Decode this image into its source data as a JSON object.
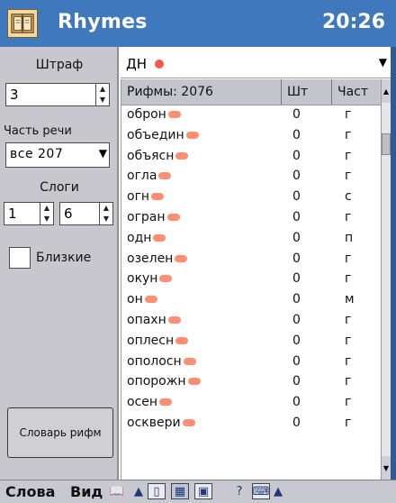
{
  "titlebar": {
    "app_title": "Rhymes",
    "clock": "20:26"
  },
  "left_panel": {
    "penalty_label": "Штраф",
    "penalty_value": "3",
    "pos_label": "Часть речи",
    "pos_value": "все   207",
    "syllables_label": "Слоги",
    "syllables_from": "1",
    "syllables_to": "6",
    "close_label": "Близкие",
    "dictionary_button": "Словарь рифм"
  },
  "search": {
    "value": "ДН"
  },
  "table": {
    "header_rhymes": "Рифмы: 2076",
    "header_count": "Шт",
    "header_part": "Част",
    "rows": [
      {
        "word": "оброн",
        "count": "0",
        "part": "г"
      },
      {
        "word": "объедин",
        "count": "0",
        "part": "г"
      },
      {
        "word": "объясн",
        "count": "0",
        "part": "г"
      },
      {
        "word": "огла",
        "count": "0",
        "part": "г"
      },
      {
        "word": "огн",
        "count": "0",
        "part": "с"
      },
      {
        "word": "огран",
        "count": "0",
        "part": "г"
      },
      {
        "word": "одн",
        "count": "0",
        "part": "п"
      },
      {
        "word": "озелен",
        "count": "0",
        "part": "г"
      },
      {
        "word": "окун",
        "count": "0",
        "part": "г"
      },
      {
        "word": "он",
        "count": "0",
        "part": "м"
      },
      {
        "word": "опахн",
        "count": "0",
        "part": "г"
      },
      {
        "word": "оплесн",
        "count": "0",
        "part": "г"
      },
      {
        "word": "ополосн",
        "count": "0",
        "part": "г"
      },
      {
        "word": "опорожн",
        "count": "0",
        "part": "г"
      },
      {
        "word": "осен",
        "count": "0",
        "part": "г"
      },
      {
        "word": "осквери",
        "count": "0",
        "part": "г"
      }
    ]
  },
  "bottom_bar": {
    "menu_words": "Слова",
    "menu_view": "Вид"
  }
}
